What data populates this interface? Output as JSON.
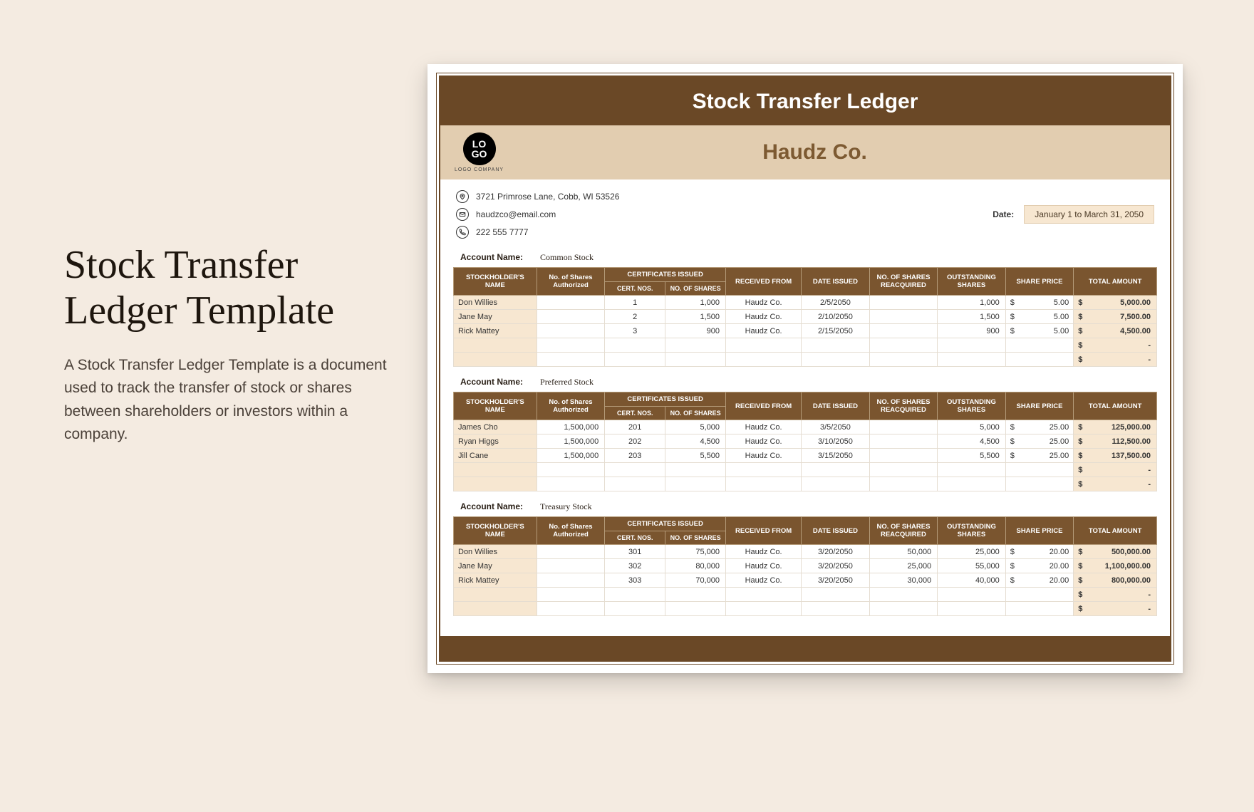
{
  "promo": {
    "title": "Stock Transfer Ledger Template",
    "desc": "A Stock Transfer Ledger Template is a document used to track the transfer of stock or shares between shareholders or investors within a company."
  },
  "doc": {
    "title": "Stock Transfer Ledger",
    "logo": {
      "mark_top": "LO",
      "mark_bot": "GO",
      "sub": "LOGO COMPANY"
    },
    "company": "Haudz Co.",
    "address": "3721 Primrose Lane, Cobb, WI 53526",
    "email": "haudzco@email.com",
    "phone": "222 555 7777",
    "date_label": "Date:",
    "date_value": "January 1 to March 31, 2050",
    "headers": {
      "account_name": "Account Name:",
      "stockholder": "STOCKHOLDER'S NAME",
      "shares_auth": "No. of Shares Authorized",
      "cert_issued": "CERTIFICATES ISSUED",
      "cert_nos": "CERT. NOS.",
      "no_shares": "NO. OF SHARES",
      "received_from": "RECEIVED FROM",
      "date_issued": "DATE ISSUED",
      "reacquired": "NO. OF SHARES REACQUIRED",
      "outstanding": "OUTSTANDING SHARES",
      "share_price": "SHARE PRICE",
      "total": "TOTAL AMOUNT",
      "currency": "$",
      "dash": "-"
    },
    "sections": [
      {
        "account": "Common Stock",
        "rows": [
          {
            "name": "Don Willies",
            "auth": "",
            "cert": "1",
            "shares": "1,000",
            "from": "Haudz Co.",
            "date": "2/5/2050",
            "reacq": "",
            "out": "1,000",
            "price": "5.00",
            "total": "5,000.00"
          },
          {
            "name": "Jane May",
            "auth": "",
            "cert": "2",
            "shares": "1,500",
            "from": "Haudz Co.",
            "date": "2/10/2050",
            "reacq": "",
            "out": "1,500",
            "price": "5.00",
            "total": "7,500.00"
          },
          {
            "name": "Rick Mattey",
            "auth": "",
            "cert": "3",
            "shares": "900",
            "from": "Haudz Co.",
            "date": "2/15/2050",
            "reacq": "",
            "out": "900",
            "price": "5.00",
            "total": "4,500.00"
          }
        ],
        "empties": 2
      },
      {
        "account": "Preferred Stock",
        "rows": [
          {
            "name": "James Cho",
            "auth": "1,500,000",
            "cert": "201",
            "shares": "5,000",
            "from": "Haudz Co.",
            "date": "3/5/2050",
            "reacq": "",
            "out": "5,000",
            "price": "25.00",
            "total": "125,000.00"
          },
          {
            "name": "Ryan Higgs",
            "auth": "1,500,000",
            "cert": "202",
            "shares": "4,500",
            "from": "Haudz Co.",
            "date": "3/10/2050",
            "reacq": "",
            "out": "4,500",
            "price": "25.00",
            "total": "112,500.00"
          },
          {
            "name": "Jill Cane",
            "auth": "1,500,000",
            "cert": "203",
            "shares": "5,500",
            "from": "Haudz Co.",
            "date": "3/15/2050",
            "reacq": "",
            "out": "5,500",
            "price": "25.00",
            "total": "137,500.00"
          }
        ],
        "empties": 2
      },
      {
        "account": "Treasury Stock",
        "rows": [
          {
            "name": "Don Willies",
            "auth": "",
            "cert": "301",
            "shares": "75,000",
            "from": "Haudz Co.",
            "date": "3/20/2050",
            "reacq": "50,000",
            "out": "25,000",
            "price": "20.00",
            "total": "500,000.00"
          },
          {
            "name": "Jane May",
            "auth": "",
            "cert": "302",
            "shares": "80,000",
            "from": "Haudz Co.",
            "date": "3/20/2050",
            "reacq": "25,000",
            "out": "55,000",
            "price": "20.00",
            "total": "1,100,000.00"
          },
          {
            "name": "Rick Mattey",
            "auth": "",
            "cert": "303",
            "shares": "70,000",
            "from": "Haudz Co.",
            "date": "3/20/2050",
            "reacq": "30,000",
            "out": "40,000",
            "price": "20.00",
            "total": "800,000.00"
          }
        ],
        "empties": 2
      }
    ]
  }
}
